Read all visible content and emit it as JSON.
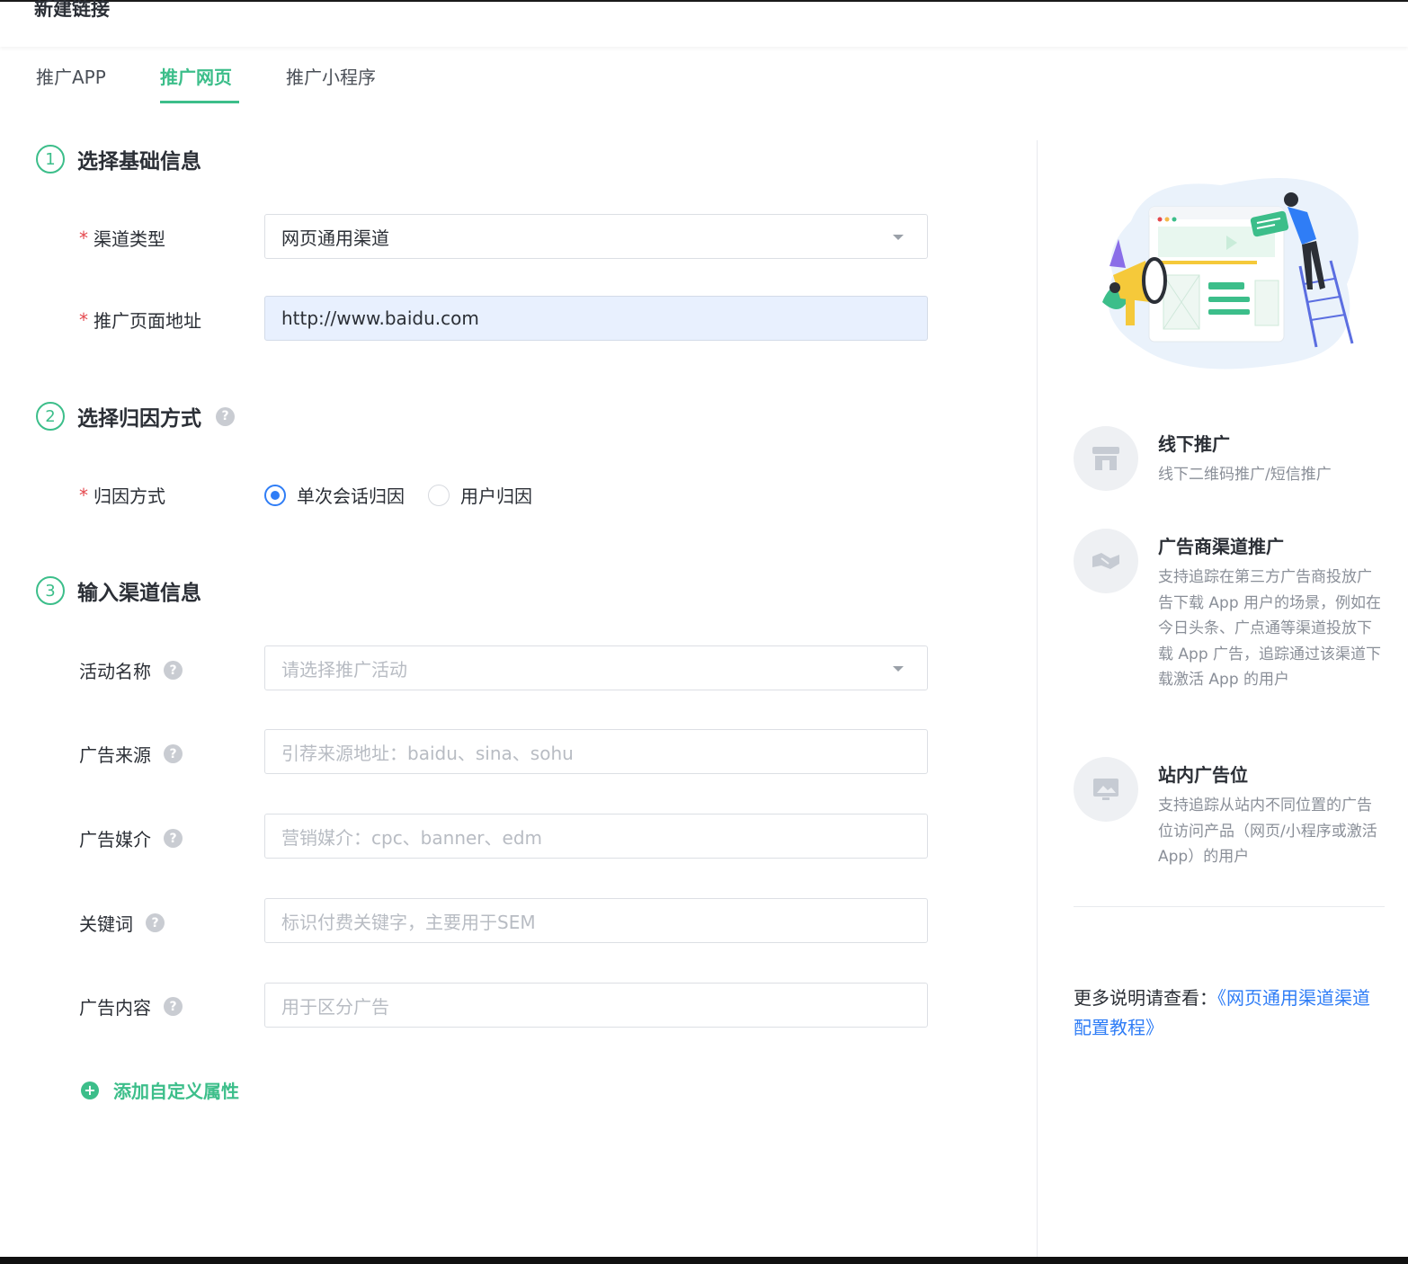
{
  "header": {
    "title": "新建链接"
  },
  "tabs": [
    {
      "label": "推广APP",
      "active": false
    },
    {
      "label": "推广网页",
      "active": true
    },
    {
      "label": "推广小程序",
      "active": false
    }
  ],
  "sections": [
    {
      "number": "1",
      "title": "选择基础信息"
    },
    {
      "number": "2",
      "title": "选择归因方式"
    },
    {
      "number": "3",
      "title": "输入渠道信息"
    }
  ],
  "basic": {
    "channel_type_label": "渠道类型",
    "channel_type_value": "网页通用渠道",
    "page_url_label": "推广页面地址",
    "page_url_value": "http://www.baidu.com"
  },
  "attribution": {
    "label": "归因方式",
    "options": [
      {
        "label": "单次会话归因",
        "checked": true
      },
      {
        "label": "用户归因",
        "checked": false
      }
    ]
  },
  "channel_info": {
    "campaign_label": "活动名称",
    "campaign_placeholder": "请选择推广活动",
    "source_label": "广告来源",
    "source_placeholder": "引荐来源地址：baidu、sina、sohu",
    "medium_label": "广告媒介",
    "medium_placeholder": "营销媒介：cpc、banner、edm",
    "keyword_label": "关键词",
    "keyword_placeholder": "标识付费关键字，主要用于SEM",
    "content_label": "广告内容",
    "content_placeholder": "用于区分广告",
    "add_attr_label": "添加自定义属性"
  },
  "sidebar": {
    "items": [
      {
        "icon": "store-icon",
        "title": "线下推广",
        "desc": "线下二维码推广/短信推广"
      },
      {
        "icon": "handshake-icon",
        "title": "广告商渠道推广",
        "desc": "支持追踪在第三方广告商投放广告下载 App 用户的场景，例如在今日头条、广点通等渠道投放下载 App 广告，追踪通过该渠道下载激活 App 的用户"
      },
      {
        "icon": "image-icon",
        "title": "站内广告位",
        "desc": "支持追踪从站内不同位置的广告位访问产品（网页/小程序或激活 App）的用户"
      }
    ],
    "more_prefix": "更多说明请查看：",
    "more_link": "《网页通用渠道渠道配置教程》"
  },
  "colors": {
    "accent": "#3cbe8a",
    "link": "#2f7df6",
    "required": "#e5484d"
  }
}
